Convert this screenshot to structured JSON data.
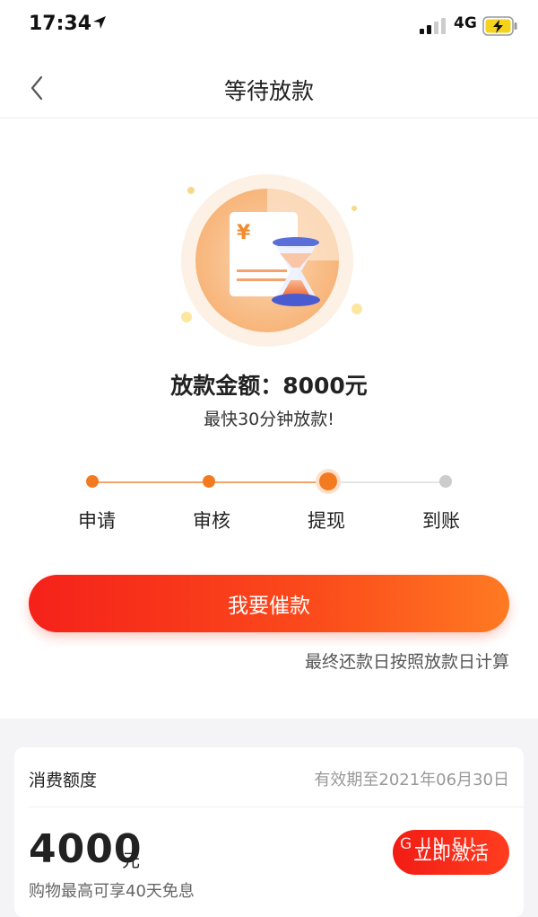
{
  "status_bar": {
    "time": "17:34",
    "network": "4G",
    "icons": [
      "location-arrow-icon",
      "signal-icon",
      "battery-charging-icon"
    ]
  },
  "nav": {
    "title": "等待放款",
    "back_icon": "chevron-left-icon"
  },
  "loan": {
    "amount_text": "放款金额：8000元",
    "eta_text": "最快30分钟放款!"
  },
  "steps": [
    {
      "label": "申请",
      "state": "done"
    },
    {
      "label": "审核",
      "state": "done"
    },
    {
      "label": "提现",
      "state": "current"
    },
    {
      "label": "到账",
      "state": "pending"
    }
  ],
  "cta_label": "我要催款",
  "repay_note": "最终还款日按照放款日计算",
  "card": {
    "title": "消费额度",
    "expiry": "有效期至2021年06月30日",
    "limit": "4000",
    "unit": "元",
    "desc": "购物最高可享40天免息",
    "button": "立即激活",
    "watermark": "G JIN FU"
  },
  "colors": {
    "accent": "#f5211a",
    "orange": "#f47a20",
    "pending": "#cccccc"
  }
}
